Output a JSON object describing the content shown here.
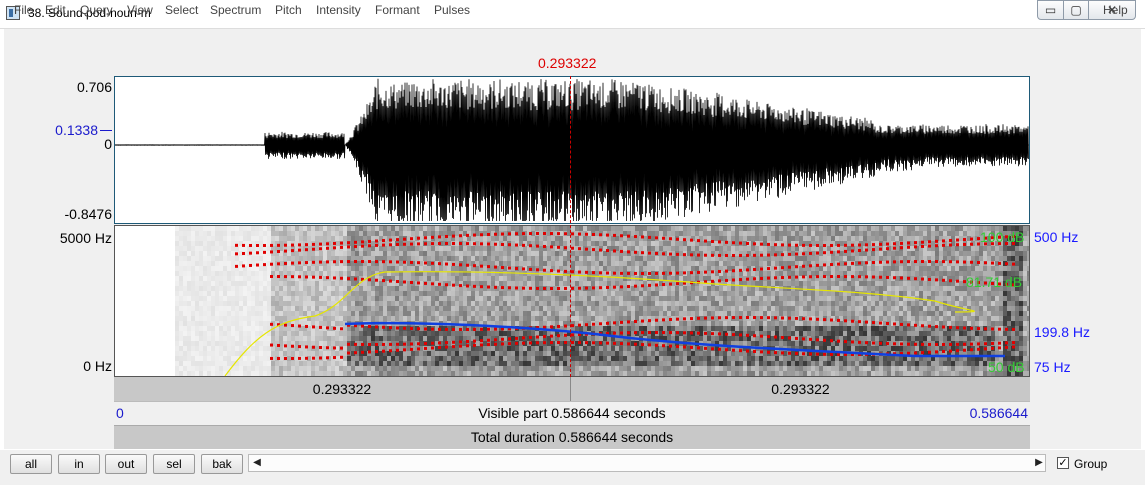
{
  "window": {
    "title": "38. Sound pod-noun-m",
    "min_glyph": "▭",
    "max_glyph": "▢",
    "close_glyph": "✕"
  },
  "menubar": {
    "items": [
      "File",
      "Edit",
      "Query",
      "View",
      "Select",
      "Spectrum",
      "Pitch",
      "Intensity",
      "Formant",
      "Pulses"
    ],
    "help": "Help"
  },
  "editor": {
    "cursor_time": "0.293322",
    "waveform": {
      "ymax": "0.706",
      "marker": "0.1338",
      "zero": "0",
      "ymin": "-0.8476"
    },
    "spectrogram": {
      "freq_top": "5000 Hz",
      "freq_bottom": "0 Hz",
      "intensity_top": "100 dB",
      "intensity_mid": "81.71 dB",
      "intensity_bottom": "50 dB",
      "pitch_top": "500 Hz",
      "pitch_value": "199.8 Hz",
      "pitch_bottom": "75 Hz"
    },
    "selection_bar": {
      "left": "0.293322",
      "right": "0.293322"
    },
    "visible_bar": {
      "start": "0",
      "label": "Visible part 0.586644 seconds",
      "end": "0.586644"
    },
    "total_bar": {
      "label": "Total duration 0.586644 seconds"
    }
  },
  "bottom": {
    "buttons": [
      "all",
      "in",
      "out",
      "sel",
      "bak"
    ],
    "scroll_left": "◀",
    "scroll_right": "▶",
    "group_label": "Group",
    "group_checked": true,
    "check_glyph": "✓"
  },
  "colors": {
    "cursor": "#cc0000",
    "formant": "#e00000",
    "intensity": "#e6e600",
    "pitch": "#1040e0",
    "pitch_label": "#1a1aff",
    "intensity_label": "#33cc33",
    "axis_blue": "#1a1acc"
  }
}
